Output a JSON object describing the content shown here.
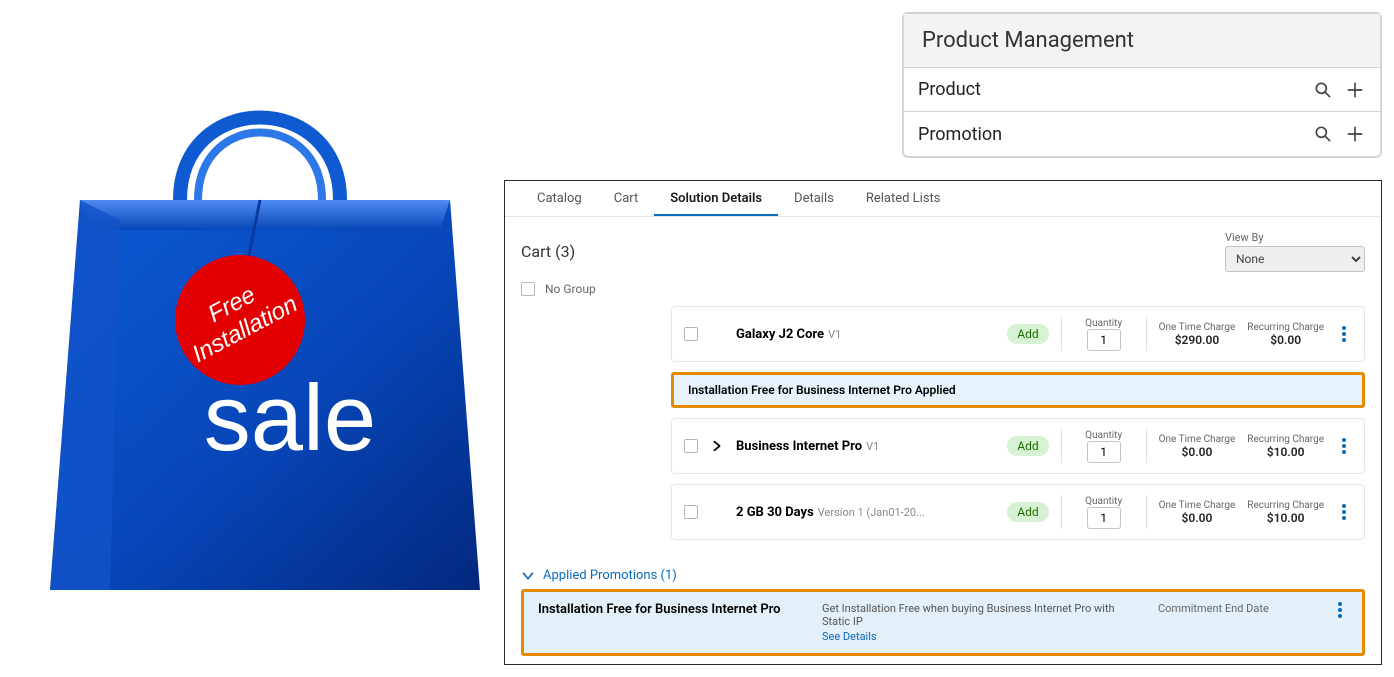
{
  "illustration": {
    "tag_line1": "Free",
    "tag_line2": "Installation",
    "sale": "sale"
  },
  "product_management": {
    "title": "Product Management",
    "rows": [
      {
        "label": "Product"
      },
      {
        "label": "Promotion"
      }
    ]
  },
  "tabs": [
    "Catalog",
    "Cart",
    "Solution Details",
    "Details",
    "Related Lists"
  ],
  "active_tab": "Solution Details",
  "cart": {
    "title": "Cart (3)",
    "view_by_label": "View By",
    "view_by_value": "None",
    "no_group_label": "No Group"
  },
  "headers": {
    "quantity": "Quantity",
    "one_time": "One Time Charge",
    "recurring": "Recurring Charge"
  },
  "items": [
    {
      "name": "Galaxy J2 Core",
      "version": "V1",
      "add": "Add",
      "qty": "1",
      "one_time": "$290.00",
      "recurring": "$0.00",
      "expandable": false
    },
    {
      "name": "Business Internet Pro",
      "version": "V1",
      "add": "Add",
      "qty": "1",
      "one_time": "$0.00",
      "recurring": "$10.00",
      "expandable": true
    },
    {
      "name": "2 GB 30 Days",
      "version": "Version 1 (Jan01-20...",
      "add": "Add",
      "qty": "1",
      "one_time": "$0.00",
      "recurring": "$10.00",
      "expandable": false
    }
  ],
  "promo_applied_banner": "Installation Free for Business Internet Pro Applied",
  "applied_promotions": {
    "label": "Applied Promotions (1)",
    "promo": {
      "name": "Installation Free for Business Internet Pro",
      "desc": "Get Installation Free when buying Business Internet Pro with Static IP",
      "see_details": "See Details",
      "commitment_label": "Commitment End Date"
    }
  }
}
